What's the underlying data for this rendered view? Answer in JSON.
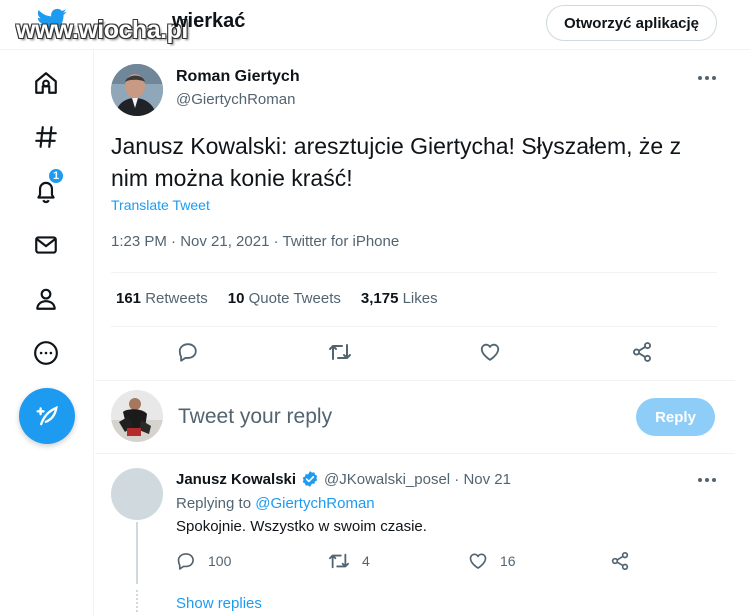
{
  "header": {
    "watermark": "www.wiocha.pl",
    "title_partial": "wierkać",
    "open_app_label": "Otworzyć aplikację"
  },
  "sidebar": {
    "items": [
      {
        "icon": "home-icon"
      },
      {
        "icon": "explore-hash-icon"
      },
      {
        "icon": "notifications-bell-icon",
        "badge": "1"
      },
      {
        "icon": "messages-mail-icon"
      },
      {
        "icon": "profile-person-icon"
      },
      {
        "icon": "more-circle-icon"
      }
    ],
    "compose_icon": "compose-feather-icon"
  },
  "tweet": {
    "author_name": "Roman Giertych",
    "author_handle": "@GiertychRoman",
    "text": "Janusz Kowalski: aresztujcie Giertycha! Słyszałem, że z nim można konie kraść!",
    "translate_label": "Translate Tweet",
    "meta": "1:23 PM · Nov 21, 2021 · Twitter for iPhone",
    "stats": {
      "retweets_count": "161",
      "retweets_label": "Retweets",
      "quotes_count": "10",
      "quotes_label": "Quote Tweets",
      "likes_count": "3,175",
      "likes_label": "Likes"
    }
  },
  "reply_composer": {
    "placeholder": "Tweet your reply",
    "button_label": "Reply"
  },
  "reply": {
    "name": "Janusz Kowalski",
    "handle_date": "@JKowalski_posel · Nov 21",
    "replying_prefix": "Replying to",
    "replying_handle": "@GiertychRoman",
    "text": "Spokojnie. Wszystko w swoim czasie.",
    "reply_count": "100",
    "retweet_count": "4",
    "like_count": "16",
    "show_replies_label": "Show replies"
  },
  "colors": {
    "accent": "#1d9bf0",
    "reply_button_disabled": "#8ecdf8",
    "secondary_text": "#536471",
    "divider": "#eff3f4"
  }
}
